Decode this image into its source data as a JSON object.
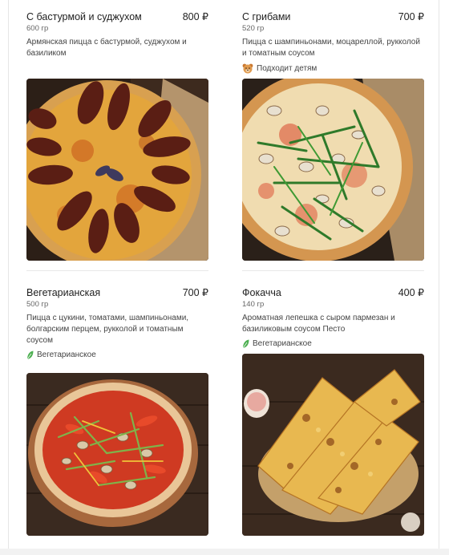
{
  "products": [
    {
      "name": "С бастурмой и суджухом",
      "price": "800 ₽",
      "weight": "600 гр",
      "description": "Армянская пицца с бастурмой, суджухом и базиликом",
      "tag": null
    },
    {
      "name": "С грибами",
      "price": "700 ₽",
      "weight": "520 гр",
      "description": "Пицца с шампиньонами, моцареллой, рукколой и томатным соусом",
      "tag": "Подходит детям",
      "tag_icon": "bear-icon"
    },
    {
      "name": "Вегетарианская",
      "price": "700 ₽",
      "weight": "500 гр",
      "description": "Пицца с цукини, томатами, шампиньонами, болгарским перцем, рукколой и томатным соусом",
      "tag": "Вегетарианское",
      "tag_icon": "leaf-icon"
    },
    {
      "name": "Фокачча",
      "price": "400 ₽",
      "weight": "140 гр",
      "description": "Ароматная лепешка с сыром пармезан и базиликовым соусом Песто",
      "tag": "Вегетарианское",
      "tag_icon": "leaf-icon"
    }
  ],
  "colors": {
    "leaf": "#4caf50",
    "bear": "#d68a3c"
  }
}
